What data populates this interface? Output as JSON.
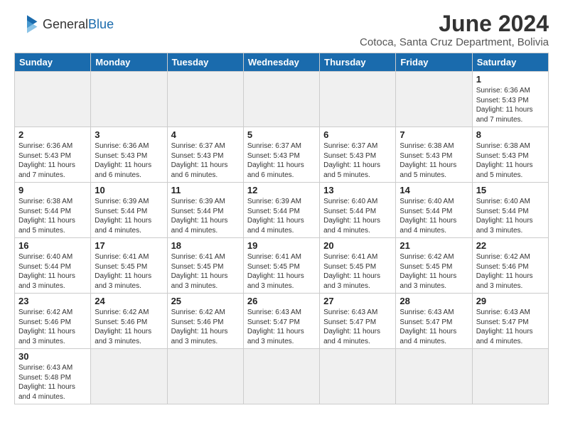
{
  "header": {
    "logo_general": "General",
    "logo_blue": "Blue",
    "month_title": "June 2024",
    "location": "Cotoca, Santa Cruz Department, Bolivia"
  },
  "weekdays": [
    "Sunday",
    "Monday",
    "Tuesday",
    "Wednesday",
    "Thursday",
    "Friday",
    "Saturday"
  ],
  "days": [
    {
      "num": "",
      "info": ""
    },
    {
      "num": "",
      "info": ""
    },
    {
      "num": "",
      "info": ""
    },
    {
      "num": "",
      "info": ""
    },
    {
      "num": "",
      "info": ""
    },
    {
      "num": "",
      "info": ""
    },
    {
      "num": "1",
      "info": "Sunrise: 6:36 AM\nSunset: 5:43 PM\nDaylight: 11 hours\nand 7 minutes."
    },
    {
      "num": "2",
      "info": "Sunrise: 6:36 AM\nSunset: 5:43 PM\nDaylight: 11 hours\nand 7 minutes."
    },
    {
      "num": "3",
      "info": "Sunrise: 6:36 AM\nSunset: 5:43 PM\nDaylight: 11 hours\nand 6 minutes."
    },
    {
      "num": "4",
      "info": "Sunrise: 6:37 AM\nSunset: 5:43 PM\nDaylight: 11 hours\nand 6 minutes."
    },
    {
      "num": "5",
      "info": "Sunrise: 6:37 AM\nSunset: 5:43 PM\nDaylight: 11 hours\nand 6 minutes."
    },
    {
      "num": "6",
      "info": "Sunrise: 6:37 AM\nSunset: 5:43 PM\nDaylight: 11 hours\nand 5 minutes."
    },
    {
      "num": "7",
      "info": "Sunrise: 6:38 AM\nSunset: 5:43 PM\nDaylight: 11 hours\nand 5 minutes."
    },
    {
      "num": "8",
      "info": "Sunrise: 6:38 AM\nSunset: 5:43 PM\nDaylight: 11 hours\nand 5 minutes."
    },
    {
      "num": "9",
      "info": "Sunrise: 6:38 AM\nSunset: 5:44 PM\nDaylight: 11 hours\nand 5 minutes."
    },
    {
      "num": "10",
      "info": "Sunrise: 6:39 AM\nSunset: 5:44 PM\nDaylight: 11 hours\nand 4 minutes."
    },
    {
      "num": "11",
      "info": "Sunrise: 6:39 AM\nSunset: 5:44 PM\nDaylight: 11 hours\nand 4 minutes."
    },
    {
      "num": "12",
      "info": "Sunrise: 6:39 AM\nSunset: 5:44 PM\nDaylight: 11 hours\nand 4 minutes."
    },
    {
      "num": "13",
      "info": "Sunrise: 6:40 AM\nSunset: 5:44 PM\nDaylight: 11 hours\nand 4 minutes."
    },
    {
      "num": "14",
      "info": "Sunrise: 6:40 AM\nSunset: 5:44 PM\nDaylight: 11 hours\nand 4 minutes."
    },
    {
      "num": "15",
      "info": "Sunrise: 6:40 AM\nSunset: 5:44 PM\nDaylight: 11 hours\nand 3 minutes."
    },
    {
      "num": "16",
      "info": "Sunrise: 6:40 AM\nSunset: 5:44 PM\nDaylight: 11 hours\nand 3 minutes."
    },
    {
      "num": "17",
      "info": "Sunrise: 6:41 AM\nSunset: 5:45 PM\nDaylight: 11 hours\nand 3 minutes."
    },
    {
      "num": "18",
      "info": "Sunrise: 6:41 AM\nSunset: 5:45 PM\nDaylight: 11 hours\nand 3 minutes."
    },
    {
      "num": "19",
      "info": "Sunrise: 6:41 AM\nSunset: 5:45 PM\nDaylight: 11 hours\nand 3 minutes."
    },
    {
      "num": "20",
      "info": "Sunrise: 6:41 AM\nSunset: 5:45 PM\nDaylight: 11 hours\nand 3 minutes."
    },
    {
      "num": "21",
      "info": "Sunrise: 6:42 AM\nSunset: 5:45 PM\nDaylight: 11 hours\nand 3 minutes."
    },
    {
      "num": "22",
      "info": "Sunrise: 6:42 AM\nSunset: 5:46 PM\nDaylight: 11 hours\nand 3 minutes."
    },
    {
      "num": "23",
      "info": "Sunrise: 6:42 AM\nSunset: 5:46 PM\nDaylight: 11 hours\nand 3 minutes."
    },
    {
      "num": "24",
      "info": "Sunrise: 6:42 AM\nSunset: 5:46 PM\nDaylight: 11 hours\nand 3 minutes."
    },
    {
      "num": "25",
      "info": "Sunrise: 6:42 AM\nSunset: 5:46 PM\nDaylight: 11 hours\nand 3 minutes."
    },
    {
      "num": "26",
      "info": "Sunrise: 6:43 AM\nSunset: 5:47 PM\nDaylight: 11 hours\nand 3 minutes."
    },
    {
      "num": "27",
      "info": "Sunrise: 6:43 AM\nSunset: 5:47 PM\nDaylight: 11 hours\nand 4 minutes."
    },
    {
      "num": "28",
      "info": "Sunrise: 6:43 AM\nSunset: 5:47 PM\nDaylight: 11 hours\nand 4 minutes."
    },
    {
      "num": "29",
      "info": "Sunrise: 6:43 AM\nSunset: 5:47 PM\nDaylight: 11 hours\nand 4 minutes."
    },
    {
      "num": "30",
      "info": "Sunrise: 6:43 AM\nSunset: 5:48 PM\nDaylight: 11 hours\nand 4 minutes."
    },
    {
      "num": "",
      "info": ""
    },
    {
      "num": "",
      "info": ""
    },
    {
      "num": "",
      "info": ""
    },
    {
      "num": "",
      "info": ""
    },
    {
      "num": "",
      "info": ""
    },
    {
      "num": "",
      "info": ""
    }
  ]
}
